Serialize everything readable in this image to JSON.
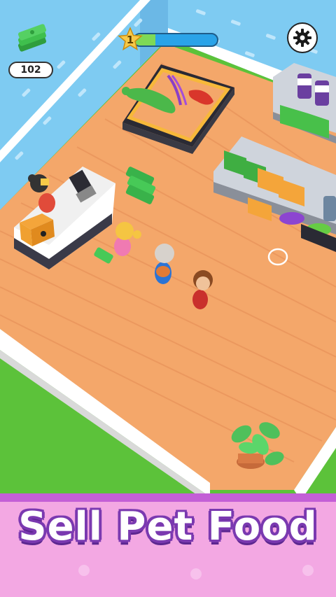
{
  "hud": {
    "cash_amount": "102",
    "level_number": "1",
    "level_progress": 0.25,
    "cash_icon": "cash-stack-icon",
    "settings_icon": "gear-icon"
  },
  "banner": {
    "headline": "Sell Pet Food"
  },
  "colors": {
    "grass": "#5cc23a",
    "floor": "#f4a76a",
    "wall": "#7ecbf2",
    "banner": "#f3a8e3",
    "banner_outline": "#7a39b0",
    "progress_track": "#2aa3e8",
    "progress_fill": "#7ed957"
  }
}
